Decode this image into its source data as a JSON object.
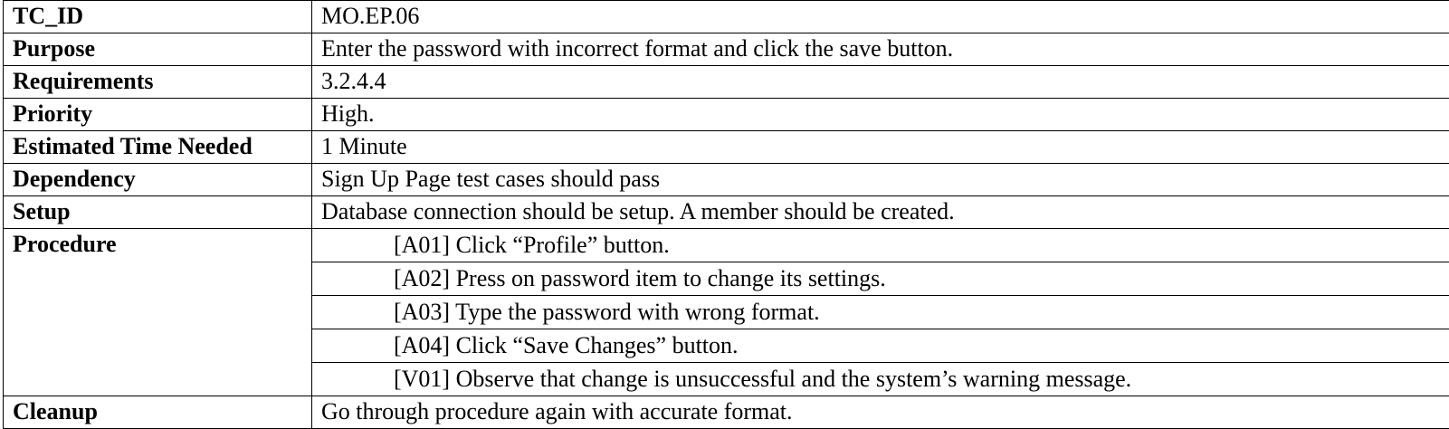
{
  "rows": [
    {
      "label": "TC_ID",
      "value": "MO.EP.06"
    },
    {
      "label": "Purpose",
      "value": "Enter the password with incorrect format and click the save button."
    },
    {
      "label": "Requirements",
      "value": "3.2.4.4"
    },
    {
      "label": "Priority",
      "value": "High."
    },
    {
      "label": "Estimated Time Needed",
      "value": "1 Minute"
    },
    {
      "label": "Dependency",
      "value": "Sign Up Page test cases should pass"
    },
    {
      "label": "Setup",
      "value": "Database connection should be setup. A member should be created."
    }
  ],
  "procedure": {
    "label": "Procedure",
    "steps": [
      "[A01] Click “Profile” button.",
      "[A02] Press on password item to change its settings.",
      "[A03] Type the password with wrong format.",
      "[A04] Click “Save Changes” button.",
      "[V01] Observe that change is unsuccessful and the system’s warning message."
    ]
  },
  "cleanup": {
    "label": "Cleanup",
    "value": "Go through procedure again with accurate format."
  }
}
